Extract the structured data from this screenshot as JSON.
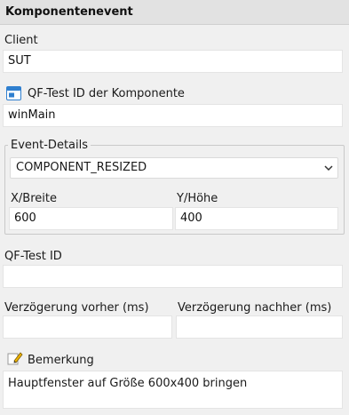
{
  "header": {
    "title": "Komponentenevent"
  },
  "client": {
    "label": "Client",
    "value": "SUT"
  },
  "component": {
    "label": "QF-Test ID der Komponente",
    "value": "winMain",
    "icon": "window-component-icon"
  },
  "event_details": {
    "group_label": "Event-Details",
    "event_select": "COMPONENT_RESIZED",
    "x": {
      "label": "X/Breite",
      "value": "600"
    },
    "y": {
      "label": "Y/Höhe",
      "value": "400"
    }
  },
  "qftest_id": {
    "label": "QF-Test ID",
    "value": ""
  },
  "delay_before": {
    "label": "Verzögerung vorher (ms)",
    "value": ""
  },
  "delay_after": {
    "label": "Verzögerung nachher (ms)",
    "value": ""
  },
  "comment": {
    "label": "Bemerkung",
    "value": "Hauptfenster auf Größe 600x400 bringen",
    "icon": "pencil-note-icon"
  },
  "colors": {
    "background": "#f0f0f0",
    "header": "#e2e2e2",
    "field": "#ffffff",
    "icon_blue": "#2f7fcf"
  }
}
